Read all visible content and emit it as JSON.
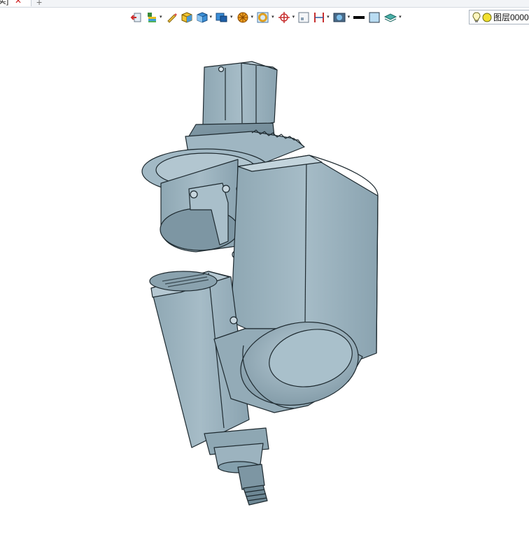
{
  "tabs": [
    {
      "label": "实]",
      "close": "✕"
    }
  ],
  "new_tab_label": "+",
  "toolbar": {
    "buttons": [
      {
        "icon": "exit-sketch-icon",
        "dropdown": false
      },
      {
        "icon": "layer-tools-icon",
        "dropdown": true
      },
      {
        "icon": "pencil-icon",
        "dropdown": false
      },
      {
        "icon": "cube-yellow-icon",
        "dropdown": false
      },
      {
        "icon": "cube-blue-icon",
        "dropdown": true
      },
      {
        "icon": "solid-view-icon",
        "dropdown": true
      },
      {
        "icon": "sphere-render-icon",
        "dropdown": true
      },
      {
        "icon": "ring-icon",
        "dropdown": true
      },
      {
        "icon": "crosshair-icon",
        "dropdown": true
      },
      {
        "icon": "frame-icon",
        "dropdown": false
      },
      {
        "icon": "dimension-icon",
        "dropdown": true
      },
      {
        "icon": "display-filter-icon",
        "dropdown": true
      },
      {
        "icon": "line-weight-icon",
        "dropdown": false
      },
      {
        "icon": "color-swatch-icon",
        "dropdown": false
      },
      {
        "icon": "layer-stack-icon",
        "dropdown": true
      }
    ],
    "dropdown_glyph": "▾"
  },
  "layer_selector": {
    "value": "图层0000",
    "lamp_icon": "lightbulb-icon",
    "status_icon": "yellow-circle-icon"
  },
  "model": {
    "name": "spindle-head-assembly",
    "body_color": "#9cb3bf",
    "edge_color": "#1e2a30"
  }
}
